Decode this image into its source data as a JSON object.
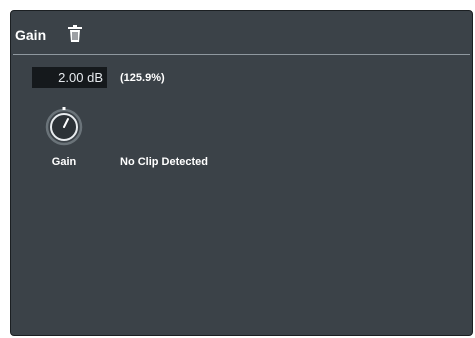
{
  "panel": {
    "title": "Gain",
    "delete_icon": "trash-icon"
  },
  "gain": {
    "value_text": "2.00 dB",
    "percent_text": "(125.9%)",
    "knob_label": "Gain",
    "knob_icon": "knob-icon"
  },
  "clip": {
    "status_text": "No Clip Detected"
  },
  "colors": {
    "panel_background": "#3b4248",
    "field_background": "#15191c",
    "text": "#ffffff",
    "divider": "#8f989f"
  }
}
